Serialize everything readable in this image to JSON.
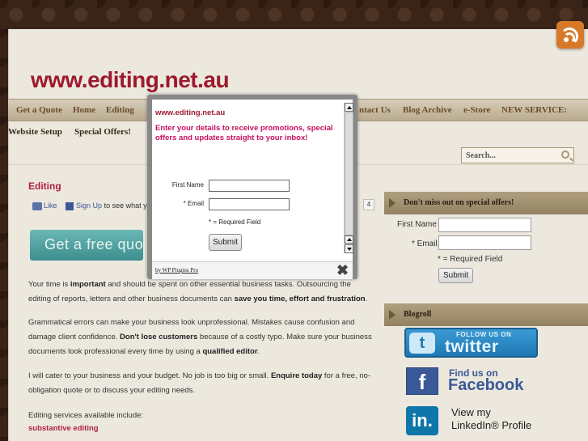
{
  "site": {
    "title": "www.editing.net.au"
  },
  "nav": {
    "row1": [
      "Get a Quote",
      "Home",
      "Editing",
      "ntact Us",
      "Blog Archive",
      "e-Store",
      "NEW SERVICE:"
    ],
    "row2": [
      "Website Setup",
      "Special Offers!"
    ]
  },
  "search": {
    "placeholder": "Search..."
  },
  "post": {
    "title": "Editing",
    "fb_like": "Like",
    "fb_signup": "Sign Up",
    "fb_rest": "to see what y",
    "like_count": "4",
    "quote_banner": "Get a free quot",
    "p1a": "Your time is ",
    "p1b": "important",
    "p1c": " and should be spent on other essential business tasks. Outsourcing the editing of reports, letters and other business documents can ",
    "p1d": "save you time, effort and frustration",
    "p1e": ".",
    "p2a": "Grammatical errors can make your business look unprofessional. Mistakes cause confusion and damage client confidence. ",
    "p2b": "Don't lose customers",
    "p2c": " because of a costly typo. Make sure your business documents look professional every time by using a ",
    "p2d": "qualified editor",
    "p2e": ".",
    "p3a": "I will cater to your business and your budget. No job is too big or small. ",
    "p3b": "Enquire today",
    "p3c": " for a free, no-obligation quote or to discuss your editing needs.",
    "p4": "Editing services available include:",
    "link1": "substantive editing"
  },
  "sidebar": {
    "offers_heading": "Don't miss out on special offers!",
    "first_name_label": "First Name",
    "email_label": "* Email",
    "required_note": "* = Required Field",
    "submit_label": "Submit",
    "blogroll_heading": "Blogroll",
    "twitter_small": "FOLLOW US ON",
    "twitter_big": "twitter",
    "twitter_glyph": "t",
    "facebook_small": "Find us on",
    "facebook_big": "Facebook",
    "facebook_glyph": "f",
    "linkedin_glyph": "in.",
    "linkedin_l1": "View my",
    "linkedin_l2": "LinkedIn® Profile"
  },
  "modal": {
    "site": "www.editing.net.au",
    "promo": "Enter your details to receive promotions, special offers and updates straight to your inbox!",
    "first_name_label": "First Name",
    "email_label": "* Email",
    "required_note": "* = Required Field",
    "submit_label": "Submit",
    "by_line": "by WP Plugins Pro",
    "close_glyph": "✖"
  },
  "colors": {
    "brand": "#9c1a2e",
    "promo": "#c8105e",
    "nav_bg": "#c9bca2"
  },
  "icons": [
    "rss-icon",
    "search-icon",
    "facebook-like-icon",
    "close-icon",
    "twitter-icon",
    "facebook-icon",
    "linkedin-icon"
  ]
}
